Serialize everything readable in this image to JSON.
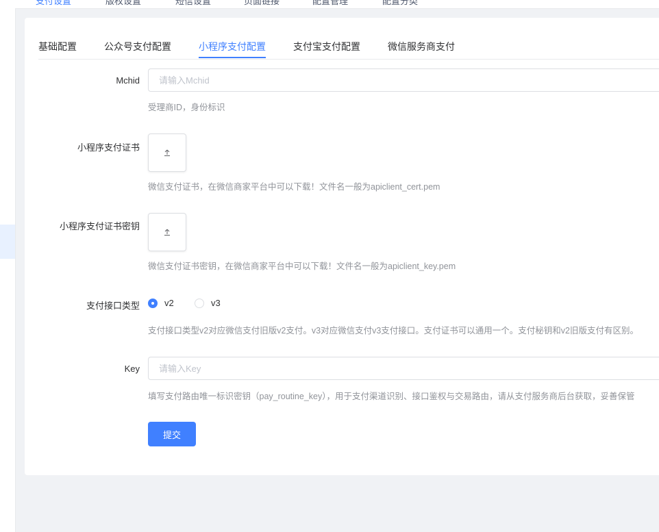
{
  "top_tabs": [
    "支付设置",
    "版权设置",
    "短信设置",
    "页面链接",
    "配置管理",
    "配置分类"
  ],
  "tabs": [
    {
      "label": "基础配置"
    },
    {
      "label": "公众号支付配置"
    },
    {
      "label": "小程序支付配置",
      "active": true
    },
    {
      "label": "支付宝支付配置"
    },
    {
      "label": "微信服务商支付"
    }
  ],
  "form": {
    "mchid": {
      "label": "Mchid",
      "placeholder": "请输入Mchid",
      "value": "",
      "help": "受理商ID，身份标识"
    },
    "cert": {
      "label": "小程序支付证书",
      "help": "微信支付证书，在微信商家平台中可以下载！文件名一般为apiclient_cert.pem"
    },
    "cert_key": {
      "label": "小程序支付证书密钥",
      "help": "微信支付证书密钥，在微信商家平台中可以下载！文件名一般为apiclient_key.pem"
    },
    "api_type": {
      "label": "支付接口类型",
      "options": [
        "v2",
        "v3"
      ],
      "selected": "v2",
      "help": "支付接口类型v2对应微信支付旧版v2支付。v3对应微信支付v3支付接口。支付证书可以通用一个。支付秘钥和v2旧版支付有区别。"
    },
    "key": {
      "label": "Key",
      "placeholder": "请输入Key",
      "value": "",
      "help": "填写支付路由唯一标识密钥（pay_routine_key），用于支付渠道识别、接口鉴权与交易路由，请从支付服务商后台获取，妥善保管"
    },
    "submit_label": "提交"
  },
  "colors": {
    "primary": "#4080ff",
    "help_text": "#909399",
    "border": "#dcdee2"
  },
  "icons": {
    "upload": "upload-icon",
    "radio": "radio-icon"
  }
}
